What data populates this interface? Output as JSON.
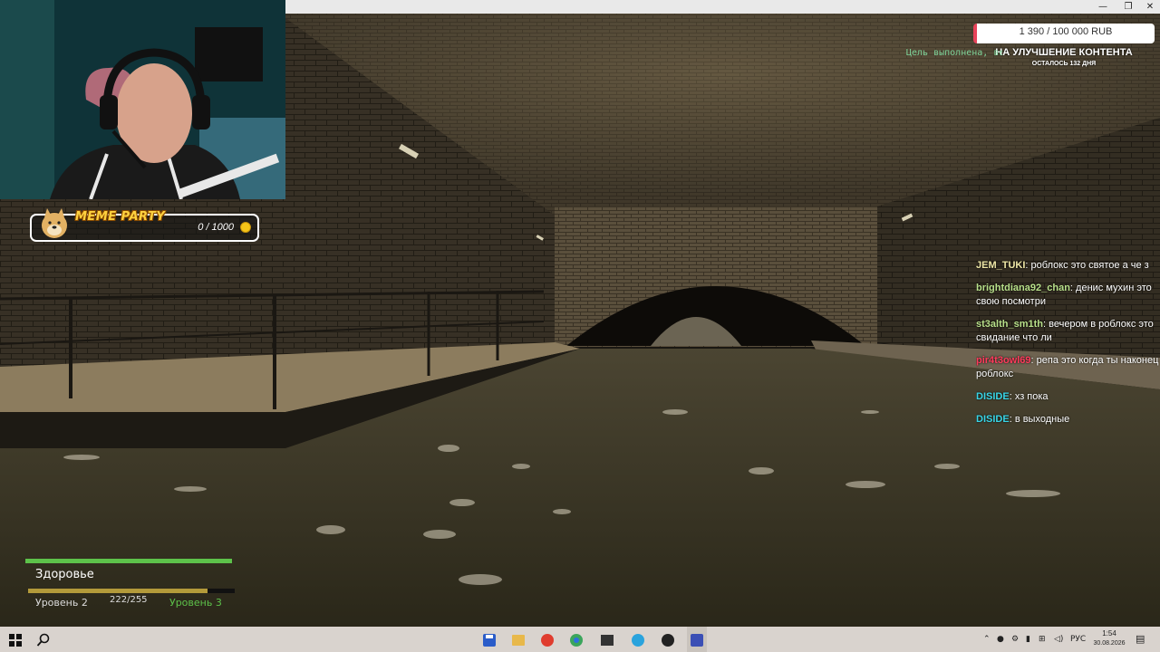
{
  "window": {
    "minimize": "—",
    "restore": "❐",
    "close": "✕"
  },
  "meme_party": {
    "title": "MEME PARTY",
    "value": "0 / 1000"
  },
  "donation": {
    "amount": "1 390 / 100 000 RUB",
    "title": "НА УЛУЧШЕНИЕ КОНТЕНТА",
    "remaining": "ОСТАЛОСЬ 132 ДНЯ",
    "progress": 0.0139
  },
  "objective": "Цель выполнена, вер",
  "chat": [
    {
      "nick": "JEM_TUKI",
      "color": "#f0e9a8",
      "text": "роблокс это святое а че з"
    },
    {
      "nick": "brightdiana92_chan",
      "color": "#b8e08a",
      "text": "денис мухин это свою посмотри"
    },
    {
      "nick": "st3alth_sm1th",
      "color": "#b8e08a",
      "text": "вечером в роблокс это свидание что ли"
    },
    {
      "nick": "pir4t3owl69",
      "color": "#ff3b5c",
      "text": "репа это когда ты наконец роблокс"
    },
    {
      "nick": "DISIDE",
      "color": "#38d6e8",
      "text": "хз пока"
    },
    {
      "nick": "DISIDE",
      "color": "#38d6e8",
      "text": "в выходные"
    }
  ],
  "hud": {
    "health_label": "Здоровье",
    "health": 1.0,
    "level_current": "Уровень 2",
    "xp": "222/255",
    "xp_fraction": 0.87,
    "level_next": "Уровень 3"
  },
  "taskbar": {
    "lang": "РУС",
    "time": "1:54",
    "date": "30.08.2026"
  },
  "colors": {
    "accent": "#5dc24a",
    "xp": "#b39a3a",
    "donate_stripe": "#e8435a"
  }
}
